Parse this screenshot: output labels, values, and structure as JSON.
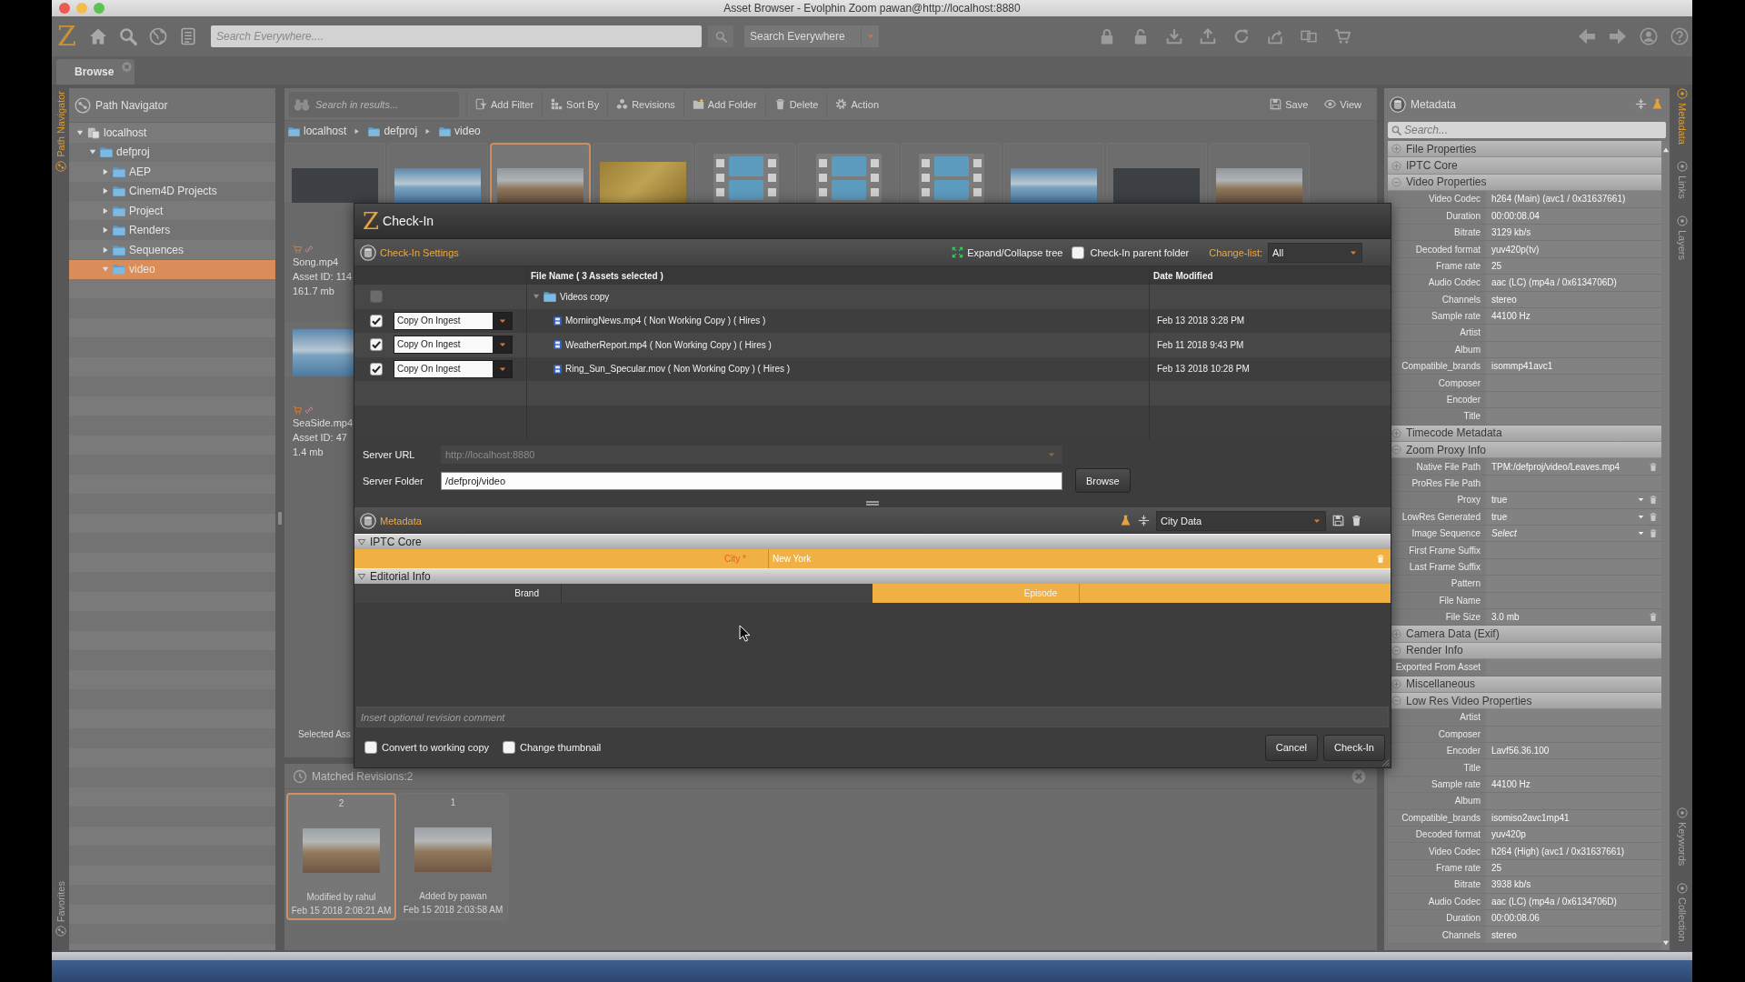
{
  "window": {
    "title": "Asset Browser - Evolphin Zoom pawan@http://localhost:8880"
  },
  "toolbar": {
    "logo": "Z",
    "search": {
      "placeholder": "Search Everywhere...."
    },
    "scope": {
      "value": "Search Everywhere"
    }
  },
  "tabs": [
    {
      "label": "Browse",
      "selected": true
    }
  ],
  "left_strip": {
    "top": [
      {
        "label": "Path Navigator",
        "selected": true
      }
    ],
    "bottom": [
      {
        "label": "Favorites",
        "selected": false
      }
    ]
  },
  "path_navigator": {
    "title": "Path Navigator",
    "tree": [
      {
        "label": "localhost",
        "kind": "server",
        "expanded": true,
        "selected": false,
        "children": [
          {
            "label": "defproj",
            "kind": "folder",
            "expanded": true,
            "selected": false,
            "children": [
              {
                "label": "AEP",
                "kind": "folder",
                "expanded": false,
                "selected": false
              },
              {
                "label": "Cinem4D Projects",
                "kind": "folder",
                "expanded": false,
                "selected": false
              },
              {
                "label": "Project",
                "kind": "folder",
                "expanded": false,
                "selected": false
              },
              {
                "label": "Renders",
                "kind": "folder",
                "expanded": false,
                "selected": false
              },
              {
                "label": "Sequences",
                "kind": "folder",
                "expanded": false,
                "selected": false
              },
              {
                "label": "video",
                "kind": "folder",
                "expanded": true,
                "selected": true
              }
            ]
          }
        ]
      }
    ]
  },
  "results": {
    "search": {
      "placeholder": "Search in results..."
    },
    "actions": [
      {
        "label": "Add Filter",
        "kind": "filter"
      },
      {
        "label": "Sort By",
        "kind": "sort"
      },
      {
        "label": "Revisions",
        "kind": "revisions"
      },
      {
        "label": "Add Folder",
        "kind": "add-folder"
      },
      {
        "label": "Delete",
        "kind": "delete"
      },
      {
        "label": "Action",
        "kind": "action"
      }
    ],
    "view_actions": [
      {
        "label": "Save",
        "kind": "save"
      },
      {
        "label": "View",
        "kind": "view"
      }
    ],
    "breadcrumb": [
      "localhost",
      "defproj",
      "video"
    ],
    "cards": [
      {
        "kind": "title",
        "selected": false,
        "name": "Song.mp4",
        "asset_id": "Asset ID: 114",
        "size": "161.7 mb"
      },
      {
        "kind": "seascape",
        "selected": false
      },
      {
        "kind": "rocks",
        "selected": true
      },
      {
        "kind": "gold",
        "selected": false
      },
      {
        "kind": "film",
        "selected": false
      },
      {
        "kind": "film",
        "selected": false
      },
      {
        "kind": "film",
        "selected": false
      },
      {
        "kind": "seascape",
        "selected": false
      },
      {
        "kind": "title",
        "selected": false
      },
      {
        "kind": "rocks",
        "selected": false
      }
    ],
    "cards_row_2": [
      {
        "kind": "seascape",
        "selected": false,
        "name": "SeaSide.mp4",
        "asset_id": "Asset ID: 47",
        "size": "1.4 mb"
      }
    ],
    "selection_status": "Selected Ass"
  },
  "revisions": {
    "title": "Matched Revisions:2",
    "items": [
      {
        "number": "2",
        "caption": "Modified by rahul",
        "date": "Feb 15 2018 2:08:21 AM",
        "selected": true
      },
      {
        "number": "1",
        "caption": "Added by pawan",
        "date": "Feb 15 2018 2:03:58 AM",
        "selected": false
      }
    ]
  },
  "check_in": {
    "logo": "Z",
    "title": "Check-In",
    "settings": {
      "title": "Check-In Settings",
      "expand_collapse": "Expand/Collapse tree",
      "parent_folder": {
        "label": "Check-In parent folder",
        "checked": false
      },
      "change_list": {
        "label": "Change-list:",
        "value": "All"
      }
    },
    "files": {
      "columns": [
        "File Name ( 3 Assets selected )",
        "Date Modified"
      ],
      "folder": {
        "name": "Videos copy",
        "expanded": true,
        "checked": false,
        "disabled": true
      },
      "rows": [
        {
          "checked": true,
          "mode": "Copy On Ingest",
          "name": "MorningNews.mp4 ( Non Working Copy ) ( Hires )",
          "date": "Feb 13 2018 3:28 PM"
        },
        {
          "checked": true,
          "mode": "Copy On Ingest",
          "name": "WeatherReport.mp4 ( Non Working Copy ) ( Hires )",
          "date": "Feb 11 2018 9:43 PM"
        },
        {
          "checked": true,
          "mode": "Copy On Ingest",
          "name": "Ring_Sun_Specular.mov ( Non Working Copy ) ( Hires )",
          "date": "Feb 13 2018 10:28 PM"
        }
      ]
    },
    "server_url": {
      "label": "Server URL",
      "value": "http://localhost:8880",
      "disabled": true
    },
    "server_folder": {
      "label": "Server Folder",
      "value": "/defproj/video"
    },
    "browse": "Browse",
    "metadata": {
      "title": "Metadata",
      "template": "City Data",
      "groups": [
        {
          "title": "IPTC Core",
          "expanded": true,
          "fields": [
            {
              "label": "City *",
              "value": "New York",
              "required": true,
              "highlighted": true,
              "removable": true
            }
          ]
        },
        {
          "title": "Editorial Info",
          "expanded": true,
          "fields": [
            {
              "label": "Brand",
              "required": false,
              "highlighted": false,
              "removable": false
            },
            {
              "label": "Episode",
              "required": false,
              "highlighted": true,
              "removable": false
            }
          ]
        }
      ]
    },
    "comment": {
      "placeholder": "Insert optional revision comment"
    },
    "options": [
      {
        "label": "Convert to working copy",
        "checked": false
      },
      {
        "label": "Change thumbnail",
        "checked": false
      }
    ],
    "buttons": [
      "Cancel",
      "Check-In"
    ]
  },
  "metadata_panel": {
    "title": "Metadata",
    "search": {
      "placeholder": "Search..."
    },
    "sections": [
      {
        "title": "File Properties",
        "expanded": false
      },
      {
        "title": "IPTC Core",
        "expanded": false
      },
      {
        "title": "Video Properties",
        "expanded": true,
        "fields": [
          {
            "label": "Video Codec",
            "value": "h264 (Main) (avc1 / 0x31637661)"
          },
          {
            "label": "Duration",
            "value": "00:00:08.04"
          },
          {
            "label": "Bitrate",
            "value": "3129 kb/s"
          },
          {
            "label": "Decoded format",
            "value": "yuv420p(tv)"
          },
          {
            "label": "Frame rate",
            "value": "25"
          },
          {
            "label": "Audio Codec",
            "value": "aac (LC) (mp4a / 0x6134706D)"
          },
          {
            "label": "Channels",
            "value": "stereo"
          },
          {
            "label": "Sample rate",
            "value": "44100 Hz"
          },
          {
            "label": "Artist"
          },
          {
            "label": "Album"
          },
          {
            "label": "Compatible_brands",
            "value": "isommp41avc1"
          },
          {
            "label": "Composer"
          },
          {
            "label": "Encoder"
          },
          {
            "label": "Title"
          }
        ]
      },
      {
        "title": "Timecode Metadata",
        "expanded": false
      },
      {
        "title": "Zoom Proxy Info",
        "expanded": true,
        "fields": [
          {
            "label": "Native File Path",
            "value": "TPM:/defproj/video/Leaves.mp4",
            "kind": "text",
            "removable": true
          },
          {
            "label": "ProRes File Path",
            "kind": "text",
            "removable": false
          },
          {
            "label": "Proxy",
            "value": "true",
            "kind": "select",
            "removable": true
          },
          {
            "label": "LowRes Generated",
            "value": "true",
            "kind": "select",
            "removable": true
          },
          {
            "label": "Image Sequence",
            "placeholder": "Select",
            "kind": "select",
            "removable": true
          },
          {
            "label": "First Frame Suffix",
            "kind": "text",
            "removable": false
          },
          {
            "label": "Last Frame Suffix",
            "kind": "text",
            "removable": false
          },
          {
            "label": "Pattern",
            "kind": "text",
            "removable": false
          },
          {
            "label": "File Name",
            "kind": "text",
            "removable": false
          },
          {
            "label": "File Size",
            "value": "3.0 mb",
            "kind": "text",
            "removable": true
          }
        ]
      },
      {
        "title": "Camera Data (Exif)",
        "expanded": false
      },
      {
        "title": "Render Info",
        "expanded": true,
        "fields": [
          {
            "label": "Exported From Asset"
          }
        ]
      },
      {
        "title": "Miscellaneous",
        "expanded": false
      },
      {
        "title": "Low Res Video Properties",
        "expanded": true,
        "fields": [
          {
            "label": "Artist"
          },
          {
            "label": "Composer"
          },
          {
            "label": "Encoder",
            "value": "Lavf56.36.100"
          },
          {
            "label": "Title"
          },
          {
            "label": "Sample rate",
            "value": "44100 Hz"
          },
          {
            "label": "Album"
          },
          {
            "label": "Compatible_brands",
            "value": "isomiso2avc1mp41"
          },
          {
            "label": "Decoded format",
            "value": "yuv420p"
          },
          {
            "label": "Video Codec",
            "value": "h264 (High) (avc1 / 0x31637661)"
          },
          {
            "label": "Frame rate",
            "value": "25"
          },
          {
            "label": "Bitrate",
            "value": "3938 kb/s"
          },
          {
            "label": "Audio Codec",
            "value": "aac (LC) (mp4a / 0x6134706D)"
          },
          {
            "label": "Duration",
            "value": "00:00:08.06"
          },
          {
            "label": "Channels",
            "value": "stereo"
          }
        ]
      }
    ]
  },
  "right_strip": {
    "top": [
      {
        "label": "Metadata",
        "selected": true
      },
      {
        "label": "Links",
        "selected": false
      },
      {
        "label": "Layers",
        "selected": false
      }
    ],
    "bottom": [
      {
        "label": "Keywords",
        "selected": false
      },
      {
        "label": "Collection",
        "selected": false
      }
    ]
  }
}
